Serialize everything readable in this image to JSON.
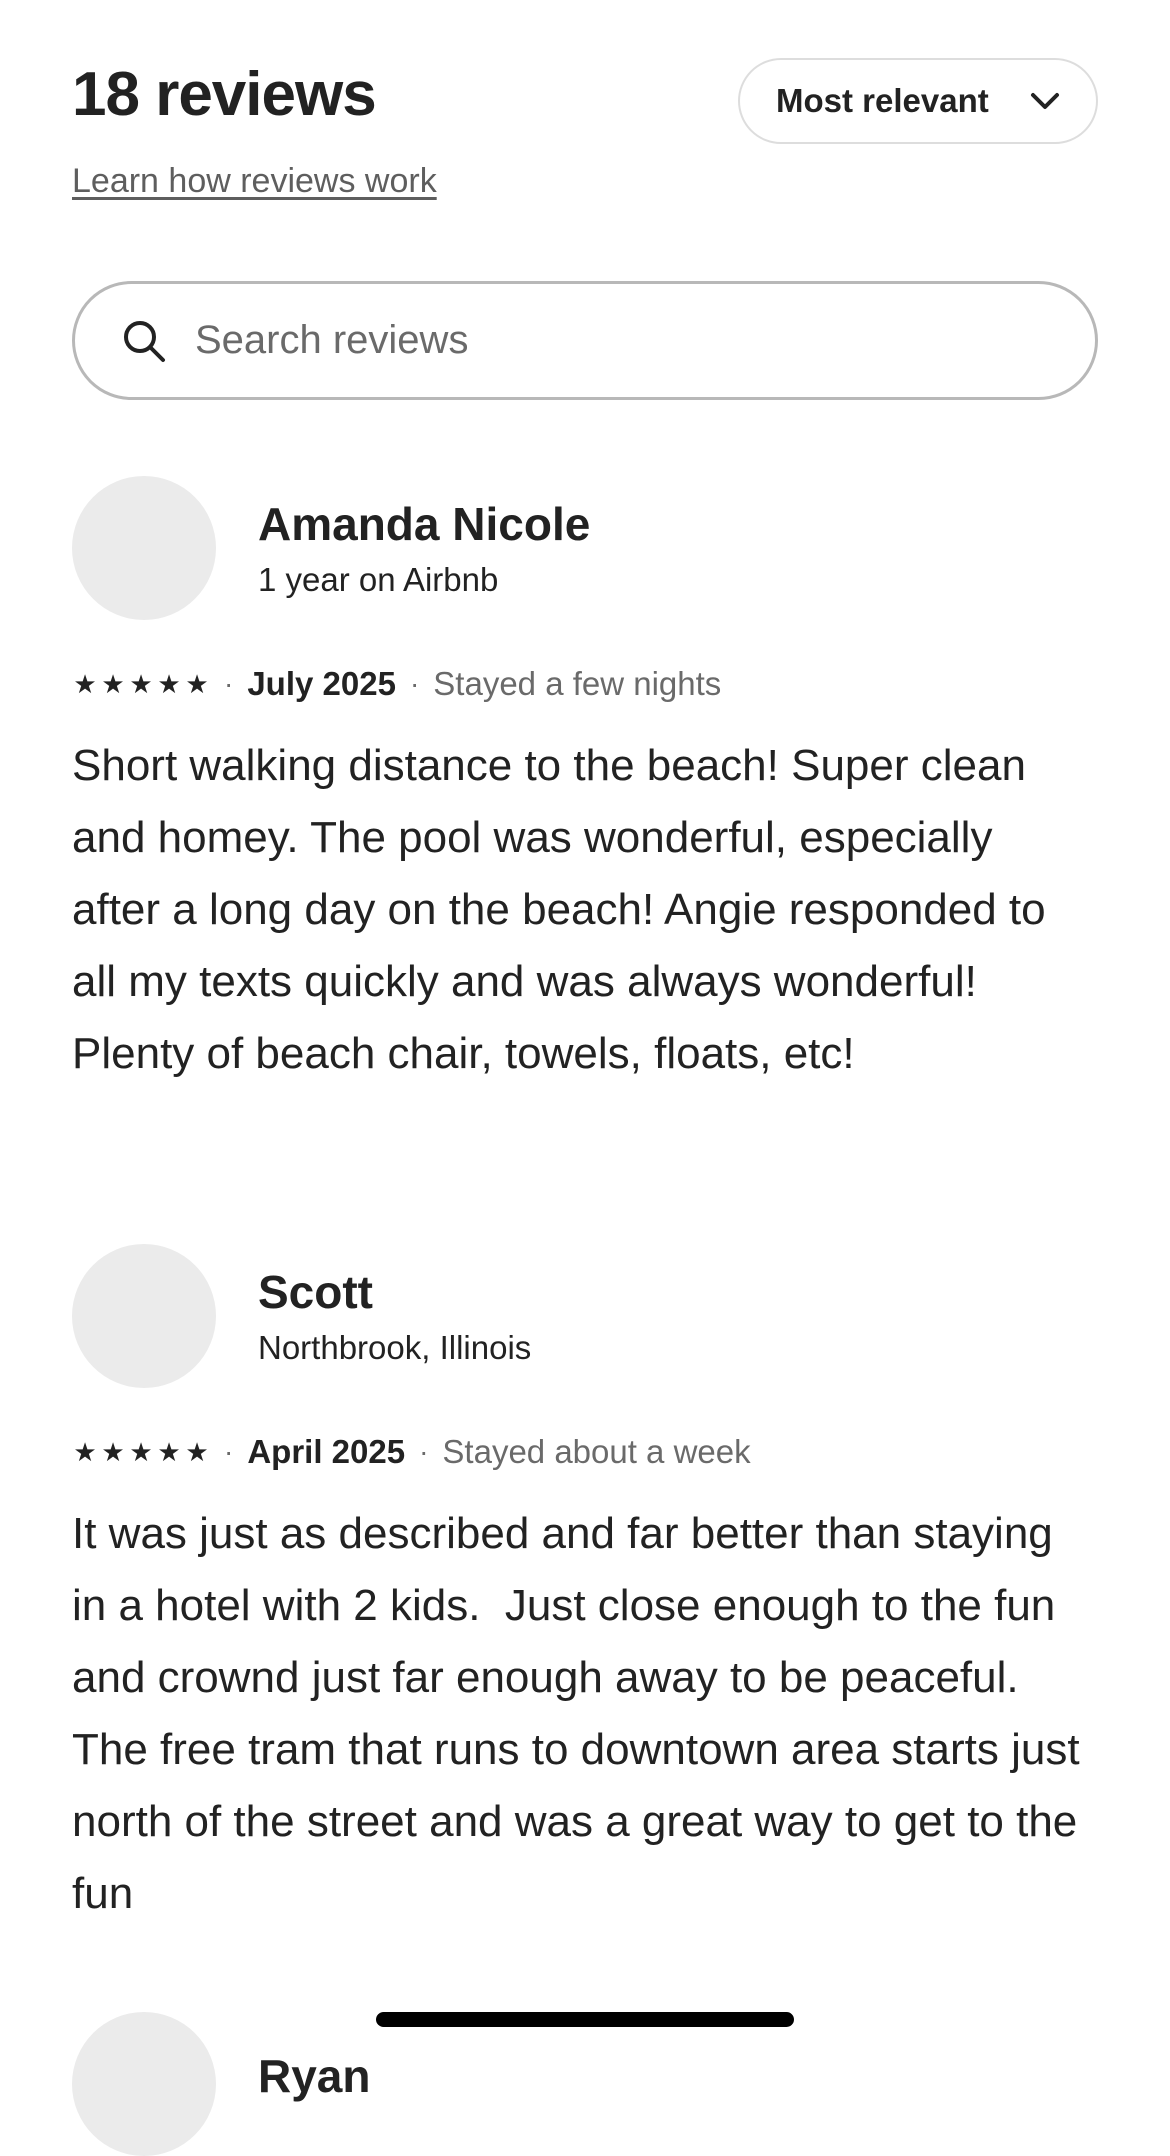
{
  "header": {
    "title": "18 reviews",
    "learn_link": "Learn how reviews work",
    "sort_label": "Most relevant"
  },
  "search": {
    "placeholder": "Search reviews",
    "value": ""
  },
  "reviews": [
    {
      "name": "Amanda Nicole",
      "subtitle": "1 year on Airbnb",
      "rating": 5,
      "date": "July 2025",
      "stay": "Stayed a few nights",
      "text": "Short walking distance to the beach! Super clean and homey. The pool was wonderful, especially after a long day on the beach! Angie responded to all my texts quickly and was always wonderful! Plenty of beach chair, towels, floats, etc!"
    },
    {
      "name": "Scott",
      "subtitle": "Northbrook, Illinois",
      "rating": 5,
      "date": "April 2025",
      "stay": "Stayed about a week",
      "text": "It was just as described and far better than staying in a hotel with 2 kids.  Just close enough to the fun and crownd just far enough away to be peaceful.  The free tram that runs to downtown area starts just north of the street and was a great way to get to the fun"
    },
    {
      "name": "Ryan"
    }
  ],
  "icons": {
    "search": "search-icon",
    "chevron": "chevron-down-icon",
    "star": "star-icon"
  },
  "colors": {
    "text_primary": "#222222",
    "text_secondary": "#6a6a6a",
    "avatar_placeholder": "#ebebeb",
    "border": "#b8b8b8"
  }
}
